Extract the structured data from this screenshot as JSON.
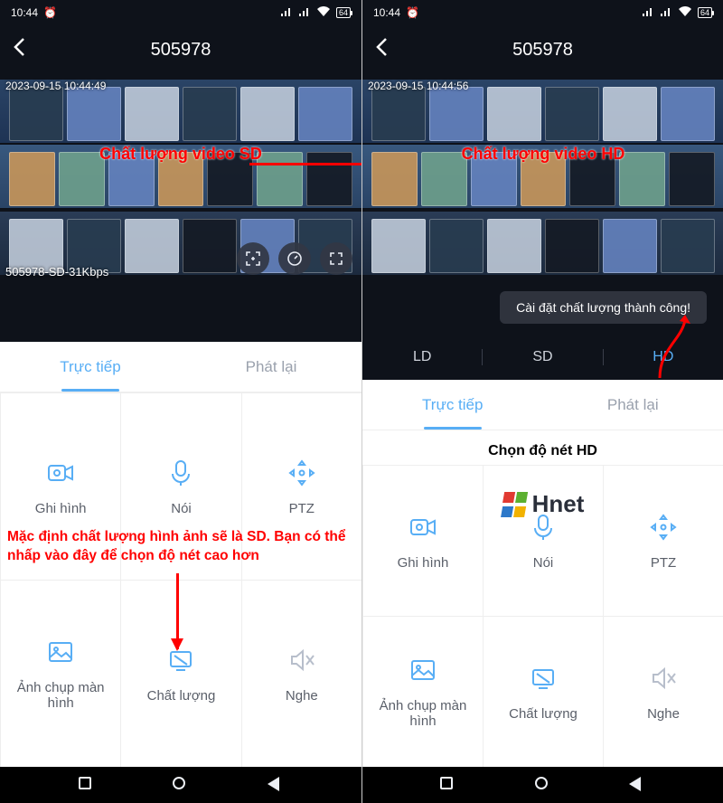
{
  "status": {
    "time": "10:44",
    "alarm_icon": "alarm-icon",
    "signal_icon": "signal-icon",
    "wifi_icon": "wifi-icon",
    "battery_pct": "64"
  },
  "header": {
    "back_icon": "chevron-left-icon",
    "title": "505978"
  },
  "left": {
    "video": {
      "timestamp": "2023-09-15 10:44:49",
      "status_overlay": "505978-SD-31Kbps",
      "annotation": "Chất lượng video SD"
    },
    "tabs": {
      "live": "Trực tiếp",
      "playback": "Phát lại",
      "active": "live"
    },
    "grid": {
      "record": {
        "label": "Ghi hình",
        "icon": "record-icon"
      },
      "talk": {
        "label": "Nói",
        "icon": "mic-icon"
      },
      "ptz": {
        "label": "PTZ",
        "icon": "ptz-icon"
      },
      "screenshot": {
        "label": "Ảnh chụp màn hình",
        "icon": "screenshot-icon"
      },
      "quality": {
        "label": "Chất lượng",
        "icon": "quality-icon"
      },
      "listen": {
        "label": "Nghe",
        "icon": "speaker-off-icon"
      }
    },
    "instruction": "Mặc định chất lượng hình ảnh sẽ là SD. Bạn có thể nhấp vào đây để chọn độ nét cao hơn"
  },
  "right": {
    "video": {
      "timestamp": "2023-09-15 10:44:56",
      "annotation": "Chất lượng video HD"
    },
    "toast": "Cài đặt chất lượng thành công!",
    "quality_row": {
      "ld": "LD",
      "sd": "SD",
      "hd": "HD",
      "active": "hd"
    },
    "tabs": {
      "live": "Trực tiếp",
      "playback": "Phát lại",
      "active": "live"
    },
    "hint": "Chọn độ nét HD",
    "grid": {
      "record": {
        "label": "Ghi hình",
        "icon": "record-icon"
      },
      "talk": {
        "label": "Nói",
        "icon": "mic-icon"
      },
      "ptz": {
        "label": "PTZ",
        "icon": "ptz-icon"
      },
      "screenshot": {
        "label": "Ảnh chụp màn hình",
        "icon": "screenshot-icon"
      },
      "quality": {
        "label": "Chất lượng",
        "icon": "quality-icon"
      },
      "listen": {
        "label": "Nghe",
        "icon": "speaker-off-icon"
      }
    },
    "logo_text": "Hnet"
  }
}
